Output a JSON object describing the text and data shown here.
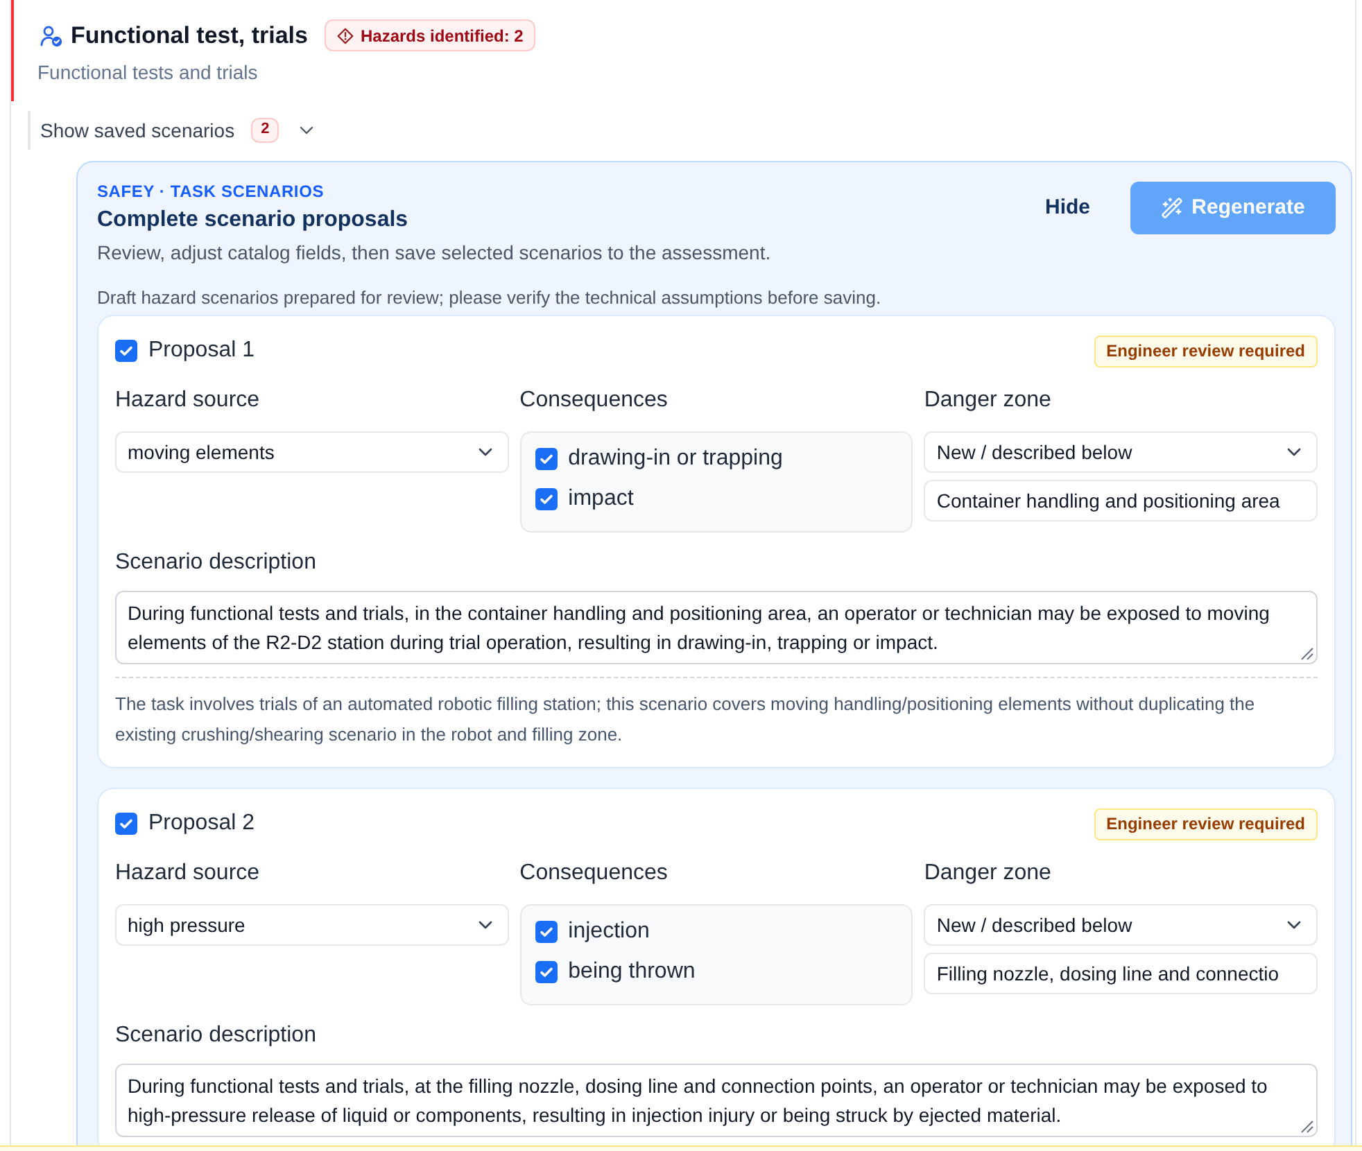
{
  "section": {
    "title": "Functional test, trials",
    "hazard_badge": "Hazards identified: 2",
    "subtitle": "Functional tests and trials"
  },
  "saved_scenarios": {
    "label": "Show saved scenarios",
    "count": "2",
    "expanded": false
  },
  "proposal_panel": {
    "eyebrow": "SAFEY · TASK SCENARIOS",
    "title": "Complete scenario proposals",
    "description": "Review, adjust catalog fields, then save selected scenarios to the assessment.",
    "buttons": [
      {
        "kind": "text",
        "label": "Hide"
      },
      {
        "kind": "primary",
        "label": "Regenerate"
      }
    ],
    "notice": "Draft hazard scenarios prepared for review; please verify the technical assumptions before saving."
  },
  "proposals": [
    {
      "checked": true,
      "title": "Proposal 1",
      "badge": "Engineer review required",
      "hazard_source": {
        "label": "Hazard source",
        "value": "moving elements"
      },
      "consequences": {
        "label": "Consequences",
        "options": [
          {
            "label": "drawing-in or trapping",
            "checked": true
          },
          {
            "label": "impact",
            "checked": true
          }
        ]
      },
      "danger_zone": {
        "label": "Danger zone",
        "value": "New / described below",
        "custom_value": "Container handling and positioning area"
      },
      "scenario_description": {
        "label": "Scenario description",
        "value": "During functional tests and trials, in the container handling and positioning area, an operator or technician may be exposed to moving elements of the R2-D2 station during trial operation, resulting in drawing-in, trapping or impact."
      },
      "rationale": "The task involves trials of an automated robotic filling station; this scenario covers moving handling/positioning elements without duplicating the existing crushing/shearing scenario in the robot and filling zone."
    },
    {
      "checked": true,
      "title": "Proposal 2",
      "badge": "Engineer review required",
      "hazard_source": {
        "label": "Hazard source",
        "value": "high pressure"
      },
      "consequences": {
        "label": "Consequences",
        "options": [
          {
            "label": "injection",
            "checked": true
          },
          {
            "label": "being thrown",
            "checked": true
          }
        ]
      },
      "danger_zone": {
        "label": "Danger zone",
        "value": "New / described below",
        "custom_value": "Filling nozzle, dosing line and connectio"
      },
      "scenario_description": {
        "label": "Scenario description",
        "value": "During functional tests and trials, at the filling nozzle, dosing line and connection points, an operator or technician may be exposed to high-pressure release of liquid or components, resulting in injection injury or being struck by ejected material."
      }
    }
  ]
}
